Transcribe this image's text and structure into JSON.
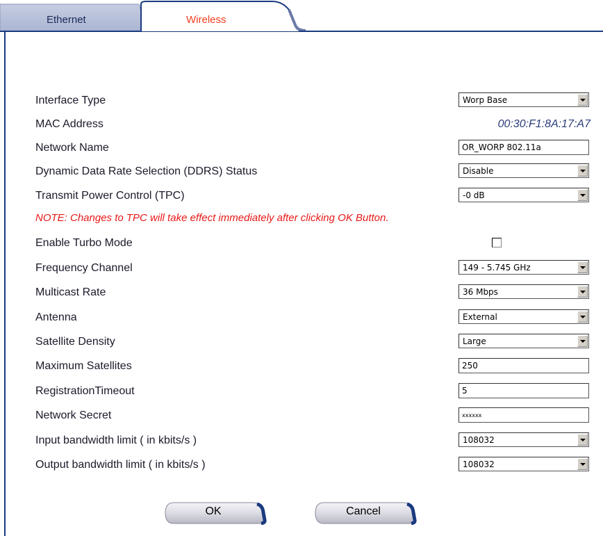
{
  "tabs": [
    {
      "label": "Ethernet",
      "active": false
    },
    {
      "label": "Wireless",
      "active": true
    }
  ],
  "form": {
    "interface_type": {
      "label": "Interface Type",
      "value": "Worp Base"
    },
    "mac_address": {
      "label": "MAC Address",
      "value": "00:30:F1:8A:17:A7"
    },
    "network_name": {
      "label": "Network Name",
      "value": "OR_WORP 802.11a"
    },
    "ddrs_status": {
      "label": "Dynamic Data Rate Selection (DDRS) Status",
      "value": "Disable"
    },
    "tpc": {
      "label": "Transmit Power Control (TPC)",
      "value": "-0 dB"
    },
    "note": "NOTE: Changes to TPC will take effect immediately after clicking OK Button.",
    "turbo_mode": {
      "label": "Enable Turbo Mode",
      "checked": false
    },
    "frequency_channel": {
      "label": "Frequency Channel",
      "value": "149 - 5.745 GHz"
    },
    "multicast_rate": {
      "label": "Multicast Rate",
      "value": "36 Mbps"
    },
    "antenna": {
      "label": "Antenna",
      "value": "External"
    },
    "satellite_density": {
      "label": "Satellite Density",
      "value": "Large"
    },
    "max_satellites": {
      "label": "Maximum Satellites",
      "value": "250"
    },
    "registration_timeout": {
      "label": "RegistrationTimeout",
      "value": "5"
    },
    "network_secret": {
      "label": "Network Secret",
      "value": "xxxxxx"
    },
    "input_bw": {
      "label": "Input bandwidth limit ( in kbits/s )",
      "value": "108032"
    },
    "output_bw": {
      "label": "Output bandwidth limit ( in kbits/s )",
      "value": "108032"
    }
  },
  "buttons": {
    "ok": "OK",
    "cancel": "Cancel"
  },
  "colors": {
    "note": "#e81818",
    "active_tab": "#f04020",
    "frame": "#1a3a80",
    "mac": "#2a3c7a"
  }
}
